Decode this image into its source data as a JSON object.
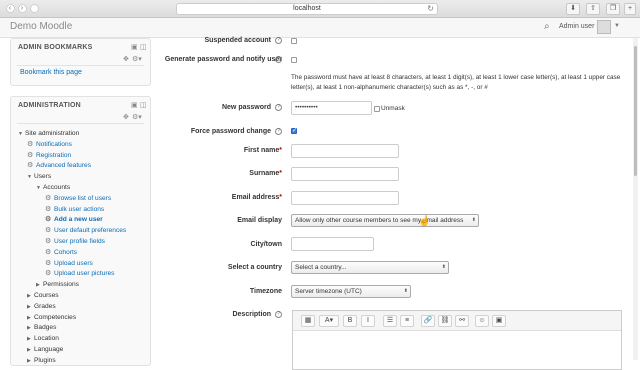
{
  "browser": {
    "url": "localhost",
    "back_icon": "chevron-left-icon",
    "forward_icon": "chevron-right-icon"
  },
  "header": {
    "site_name": "Demo Moodle",
    "user_name": "Admin user"
  },
  "sidebar": {
    "bookmarks": {
      "title": "ADMIN BOOKMARKS",
      "link": "Bookmark this page"
    },
    "administration": {
      "title": "ADMINISTRATION",
      "items": [
        {
          "label": "Site administration",
          "kind": "folder-open"
        },
        {
          "label": "Notifications",
          "kind": "link"
        },
        {
          "label": "Registration",
          "kind": "link"
        },
        {
          "label": "Advanced features",
          "kind": "link"
        },
        {
          "label": "Users",
          "kind": "folder-open"
        },
        {
          "label": "Accounts",
          "kind": "folder-open"
        },
        {
          "label": "Browse list of users",
          "kind": "link"
        },
        {
          "label": "Bulk user actions",
          "kind": "link"
        },
        {
          "label": "Add a new user",
          "kind": "active"
        },
        {
          "label": "User default preferences",
          "kind": "link"
        },
        {
          "label": "User profile fields",
          "kind": "link"
        },
        {
          "label": "Cohorts",
          "kind": "link"
        },
        {
          "label": "Upload users",
          "kind": "link"
        },
        {
          "label": "Upload user pictures",
          "kind": "link"
        },
        {
          "label": "Permissions",
          "kind": "folder"
        },
        {
          "label": "Courses",
          "kind": "folder"
        },
        {
          "label": "Grades",
          "kind": "folder"
        },
        {
          "label": "Competencies",
          "kind": "folder"
        },
        {
          "label": "Badges",
          "kind": "folder"
        },
        {
          "label": "Location",
          "kind": "folder"
        },
        {
          "label": "Language",
          "kind": "folder"
        },
        {
          "label": "Plugins",
          "kind": "folder"
        }
      ]
    }
  },
  "form": {
    "suspended_label": "Suspended account",
    "generate_label": "Generate password and notify user",
    "password_note": "The password must have at least 8 characters, at least 1 digit(s), at least 1 lower case letter(s), at least 1 upper case letter(s), at least 1 non-alphanumeric character(s) such as as *, -, or #",
    "new_password_label": "New password",
    "new_password_value": "••••••••••",
    "unmask_label": "Unmask",
    "force_change_label": "Force password change",
    "firstname_label": "First name",
    "surname_label": "Surname",
    "email_label": "Email address",
    "email_display_label": "Email display",
    "email_display_value": "Allow only other course members to see my email address",
    "city_label": "City/town",
    "country_label": "Select a country",
    "country_value": "Select a country...",
    "timezone_label": "Timezone",
    "timezone_value": "Server timezone (UTC)",
    "description_label": "Description",
    "required_marker": "*",
    "help_glyph": "?"
  },
  "editor_toolbar": [
    "▦",
    "A▾",
    "B",
    "I",
    "☰",
    "≡",
    "🔗",
    "⛓",
    "⚯",
    "☺",
    "▣"
  ],
  "colors": {
    "link": "#0a6cb5",
    "required": "#c00000",
    "checkbox_checked": "#3d7cd9"
  }
}
